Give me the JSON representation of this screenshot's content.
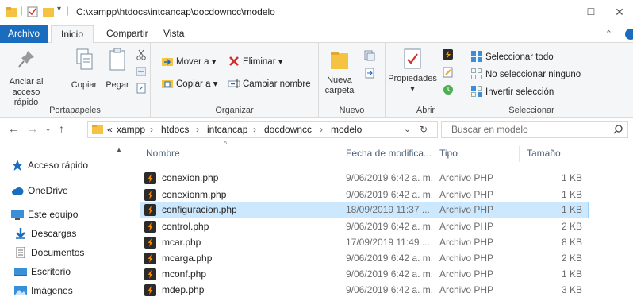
{
  "window": {
    "path": "C:\\xampp\\htdocs\\intcancap\\docdowncc\\modelo",
    "minimize_glyph": "—",
    "maximize_glyph": "☐",
    "close_glyph": "✕"
  },
  "ribbon_tabs": {
    "file": "Archivo",
    "home": "Inicio",
    "share": "Compartir",
    "view": "Vista",
    "expand_glyph": "⌃"
  },
  "ribbon": {
    "clipboard": {
      "pin": "Anclar al acceso rápido",
      "pin_line1": "Anclar al",
      "pin_line2": "acceso rápido",
      "copy": "Copiar",
      "paste": "Pegar",
      "group": "Portapapeles"
    },
    "organize": {
      "move": "Mover a",
      "copy_to": "Copiar a",
      "delete": "Eliminar",
      "rename": "Cambiar nombre",
      "group": "Organizar"
    },
    "new": {
      "folder_line1": "Nueva",
      "folder_line2": "carpeta",
      "group": "Nuevo"
    },
    "open": {
      "properties": "Propiedades",
      "group": "Abrir"
    },
    "select": {
      "all": "Seleccionar todo",
      "none": "No seleccionar ninguno",
      "invert": "Invertir selección",
      "group": "Seleccionar"
    }
  },
  "nav": {
    "back": "←",
    "forward": "→",
    "recent": "⌄",
    "up": "↑",
    "overflow": "«",
    "breadcrumb": [
      "xampp",
      "htdocs",
      "intcancap",
      "docdowncc",
      "modelo"
    ],
    "separator": "›",
    "dropdown": "⌄",
    "refresh": "↻",
    "search_placeholder": "Buscar en modelo",
    "search_glyph": "⌕"
  },
  "sidebar": {
    "items": [
      {
        "label": "Acceso rápido",
        "icon": "star-icon",
        "color": "#1a6cbf"
      },
      {
        "label": "OneDrive",
        "icon": "cloud-icon",
        "color": "#1a6cbf"
      },
      {
        "label": "Este equipo",
        "icon": "computer-icon",
        "color": "#3a8fd9"
      },
      {
        "label": "Descargas",
        "icon": "download-icon",
        "color": "#1a6cbf"
      },
      {
        "label": "Documentos",
        "icon": "document-icon",
        "color": "#6d6d6d"
      },
      {
        "label": "Escritorio",
        "icon": "desktop-icon",
        "color": "#3a8fd9"
      },
      {
        "label": "Imágenes",
        "icon": "pictures-icon",
        "color": "#3a8fd9"
      }
    ]
  },
  "list": {
    "headers": {
      "name": "Nombre",
      "date": "Fecha de modifica...",
      "type": "Tipo",
      "size": "Tamaño"
    },
    "sort_glyph": "^",
    "files": [
      {
        "name": "conexion.php",
        "date": "9/06/2019 6:42 a. m.",
        "type": "Archivo PHP",
        "size": "1 KB",
        "selected": false
      },
      {
        "name": "conexionm.php",
        "date": "9/06/2019 6:42 a. m.",
        "type": "Archivo PHP",
        "size": "1 KB",
        "selected": false
      },
      {
        "name": "configuracion.php",
        "date": "18/09/2019 11:37 ...",
        "type": "Archivo PHP",
        "size": "1 KB",
        "selected": true
      },
      {
        "name": "control.php",
        "date": "9/06/2019 6:42 a. m.",
        "type": "Archivo PHP",
        "size": "2 KB",
        "selected": false
      },
      {
        "name": "mcar.php",
        "date": "17/09/2019 11:49 ...",
        "type": "Archivo PHP",
        "size": "8 KB",
        "selected": false
      },
      {
        "name": "mcarga.php",
        "date": "9/06/2019 6:42 a. m.",
        "type": "Archivo PHP",
        "size": "2 KB",
        "selected": false
      },
      {
        "name": "mconf.php",
        "date": "9/06/2019 6:42 a. m.",
        "type": "Archivo PHP",
        "size": "1 KB",
        "selected": false
      },
      {
        "name": "mdep.php",
        "date": "9/06/2019 6:42 a. m.",
        "type": "Archivo PHP",
        "size": "3 KB",
        "selected": false
      }
    ]
  },
  "colors": {
    "accent": "#1a6cbf",
    "selection_bg": "#cce8ff",
    "selection_border": "#99d1ff",
    "folder": "#f5c342"
  }
}
